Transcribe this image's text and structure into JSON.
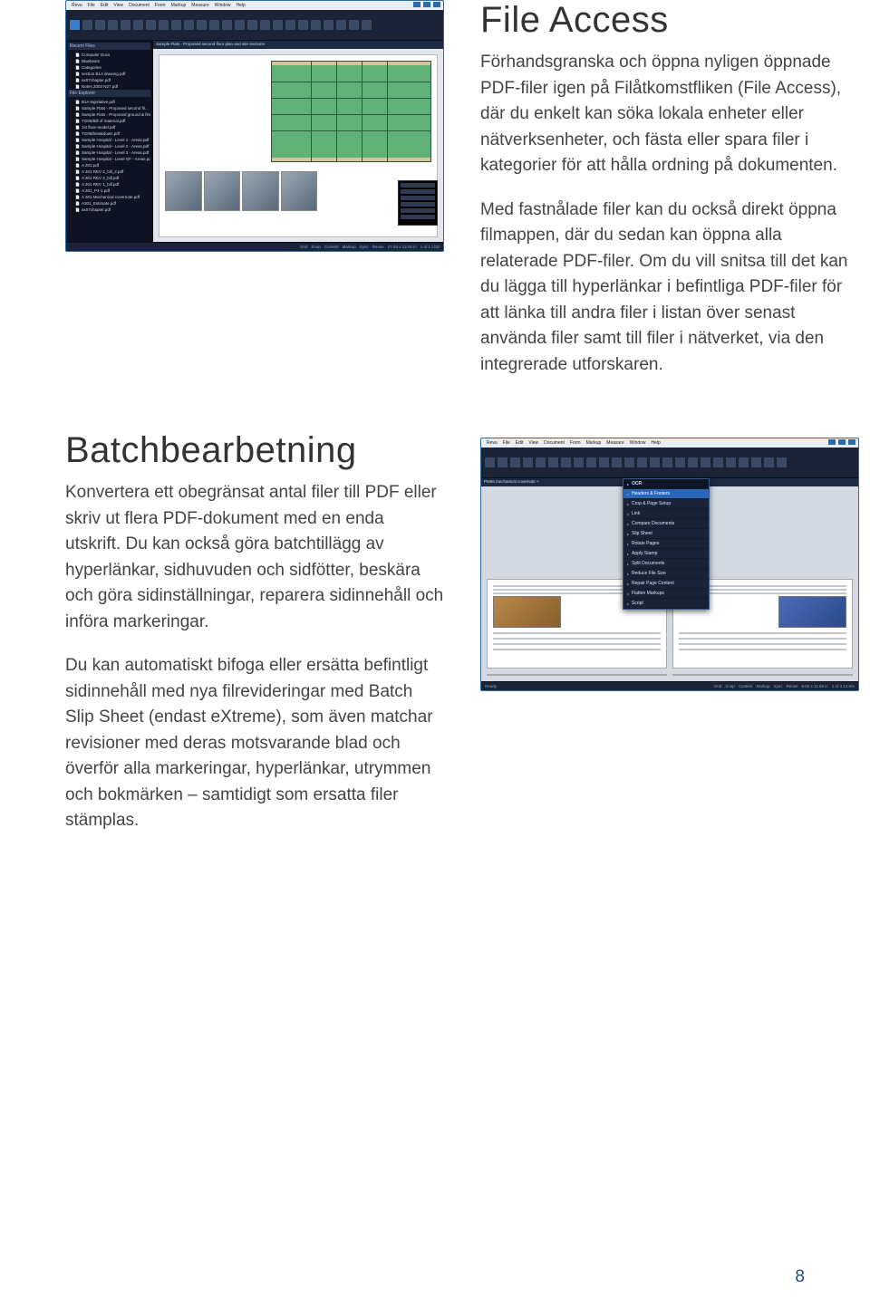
{
  "section1": {
    "heading": "File Access",
    "para1": "Förhandsgranska och öppna nyligen öppnade PDF-filer igen på Filåtkomstfliken (File Access), där du enkelt kan söka lokala enheter eller nätverksenheter, och fästa eller spara filer i kategorier för att hålla ordning på dokumenten.",
    "para2": "Med fastnålade filer kan du också direkt öppna filmappen, där du sedan kan öppna alla relaterade PDF-filer. Om du vill snitsa till det kan du lägga till hyperlänkar i befintliga PDF-filer för att länka till andra filer i listan över senast använda filer samt till filer i nätverket, via den integrerade utforskaren.",
    "mock": {
      "menus": [
        "Revu",
        "File",
        "Edit",
        "View",
        "Document",
        "Form",
        "Markup",
        "Measure",
        "Window",
        "Help"
      ],
      "tab": "Sample Flats - Proposed second floor plan and site sections",
      "sidebar_hdr1": "Recent Files",
      "sidebar_hdr2": "File Explorer",
      "tree": [
        "Computer Docs",
        "Bluebeam",
        "Categories",
        "section B1A drawing.pdf",
        "ax07chapter.pdf",
        "Notes 2003 N27.pdf"
      ],
      "files": [
        "B1A legislative.pdf",
        "Sample Flats - Proposed second flr...",
        "Sample Flats - Proposed ground & first floor pln...",
        "TG05/Bill of material.pdf",
        "1st floor-model.pdf",
        "TG05/breakdown.pdf",
        "Sample Hospital - Level 1 - Areas.pdf",
        "Sample Hospital - Level 2 - Areas.pdf",
        "Sample Hospital - Level 3 - Areas.pdf",
        "Sample Hospital - Level GF - Areas.pdf",
        "A 201.pdf",
        "A 301 REV 2_bill_2.pdf",
        "A 301 REV 2_bill.pdf",
        "A 301 REV 1_bill.pdf",
        "A 301_P4-1.pdf",
        "A 301 Mechanical covernote.pdf",
        "A301_Estimate.pdf",
        "ax07chapter.pdf"
      ],
      "status": [
        "Grid",
        "Snap",
        "Content",
        "Markup",
        "Sync",
        "Reuse",
        "27.53 x 12.00 in",
        "1 of 1  1/32"
      ]
    }
  },
  "section2": {
    "heading": "Batchbearbetning",
    "para1": "Konvertera ett obegränsat antal filer till PDF eller skriv ut flera PDF-dokument med en enda utskrift. Du kan också göra batchtillägg av hyperlänkar, sidhuvuden och sidfötter, beskära och göra sidinställningar, reparera sidinnehåll och införa markeringar.",
    "para2": "Du kan automatiskt bifoga eller ersätta befintligt sidinnehåll med nya filrevideringar med Batch Slip Sheet (endast eXtreme), som även matchar revisioner med deras motsvarande blad och överför alla markeringar, hyperlänkar, utrymmen och bokmärken – samtidigt som ersatta filer stämplas.",
    "mock": {
      "menus": [
        "Revu",
        "File",
        "Edit",
        "View",
        "Document",
        "Form",
        "Markup",
        "Measure",
        "Window",
        "Help"
      ],
      "tab": "PM06 mechanical covernote ×",
      "menu_title": "OCR",
      "menu_items": [
        "Headers & Footers",
        "Crop & Page Setup",
        "Link",
        "Compare Documents",
        "Slip Sheet",
        "Rotate Pages",
        "Apply Stamp",
        "Split Documents",
        "Reduce File Size",
        "Repair Page Content",
        "Flatten Markups",
        "Script"
      ],
      "menu_hl_index": 0,
      "status": [
        "Ready",
        "Grid",
        "Snap",
        "Content",
        "Markup",
        "Sync",
        "Reuse",
        "8.50 x 11.69 in",
        "1 of 4  14.8%"
      ]
    }
  },
  "page_number": "8"
}
